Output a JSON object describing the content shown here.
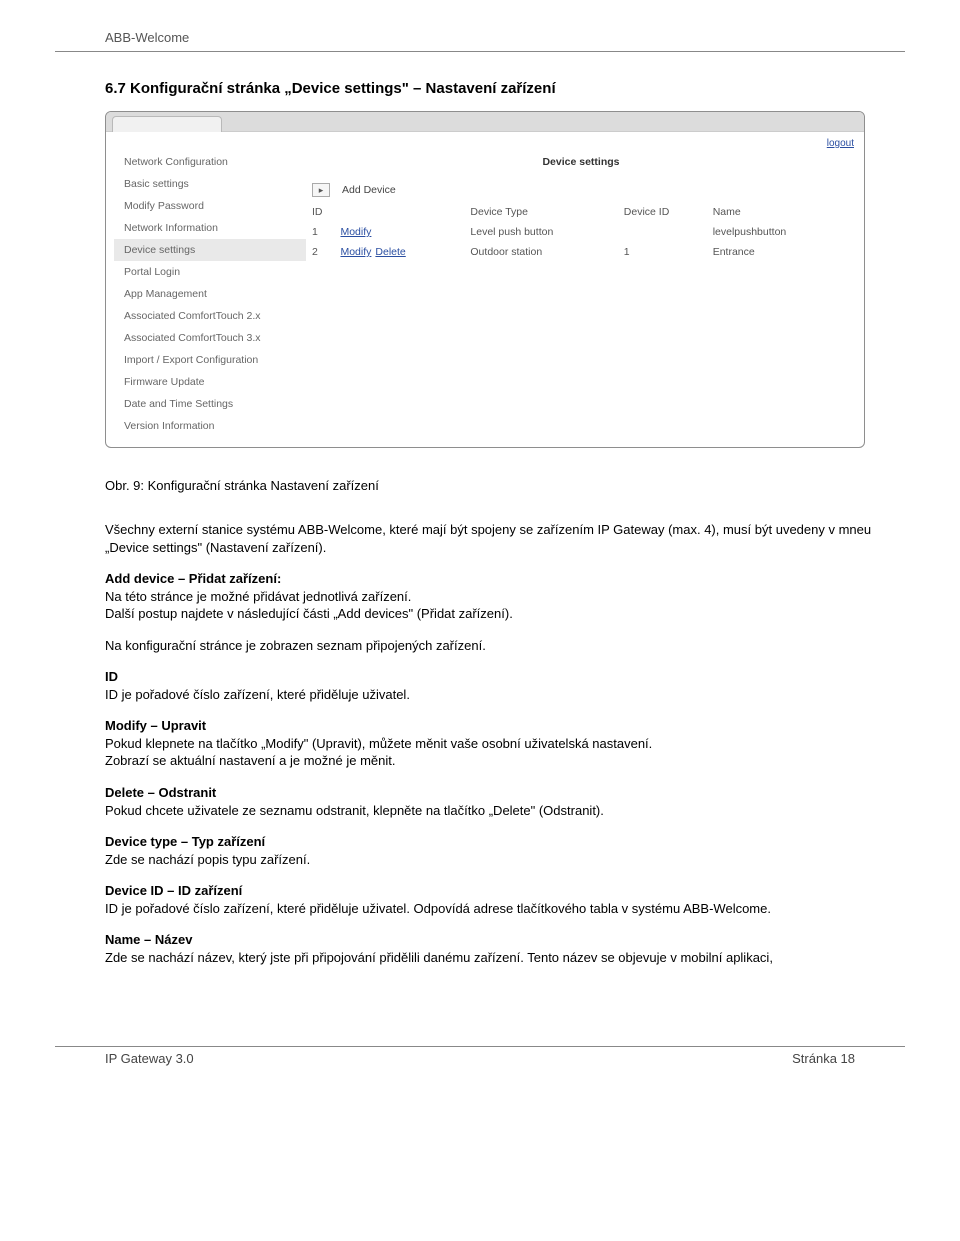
{
  "header": {
    "title": "ABB-Welcome"
  },
  "section": {
    "heading": "6.7 Konfigurační stránka „Device settings\" – Nastavení zařízení"
  },
  "screenshot": {
    "logout_label": "logout",
    "sidebar": [
      "Network Configuration",
      "Basic settings",
      "Modify Password",
      "Network Information",
      "Device settings",
      "Portal Login",
      "App Management",
      "Associated ComfortTouch 2.x",
      "Associated ComfortTouch 3.x",
      "Import / Export Configuration",
      "Firmware Update",
      "Date and Time Settings",
      "Version Information"
    ],
    "active_index": 4,
    "panel_title": "Device settings",
    "add_row": {
      "chevron": "▸",
      "label": "Add Device"
    },
    "table": {
      "headers": [
        "ID",
        "",
        "Device Type",
        "Device ID",
        "Name"
      ],
      "rows": [
        {
          "id": "1",
          "actions": [
            "Modify"
          ],
          "type": "Level push button",
          "device_id": "",
          "name": "levelpushbutton"
        },
        {
          "id": "2",
          "actions": [
            "Modify",
            "Delete"
          ],
          "type": "Outdoor station",
          "device_id": "1",
          "name": "Entrance"
        }
      ]
    }
  },
  "caption": "Obr. 9:   Konfigurační stránka Nastavení zařízení",
  "paragraphs": {
    "intro": "Všechny externí stanice systému ABB-Welcome, které mají být spojeny se zařízením IP Gateway (max. 4), musí být uvedeny v mneu „Device settings\" (Nastavení zařízení).",
    "add_h": "Add device – Přidat zařízení:",
    "add_t1": "Na této stránce je možné přidávat jednotlivá zařízení.",
    "add_t2": "Další postup najdete v následující části „Add devices\" (Přidat zařízení).",
    "list_note": "Na konfigurační stránce je zobrazen seznam připojených zařízení.",
    "id_h": "ID",
    "id_t": "ID je pořadové číslo zařízení, které přiděluje uživatel.",
    "mod_h": "Modify – Upravit",
    "mod_t1": "Pokud klepnete na tlačítko „Modify\" (Upravit), můžete měnit vaše osobní uživatelská nastavení.",
    "mod_t2": "Zobrazí se aktuální nastavení a je možné je měnit.",
    "del_h": "Delete – Odstranit",
    "del_t": "Pokud chcete uživatele ze seznamu odstranit, klepněte na tlačítko „Delete\" (Odstranit).",
    "type_h": "Device type – Typ zařízení",
    "type_t": "Zde se nachází popis typu zařízení.",
    "devid_h": "Device ID – ID zařízení",
    "devid_t": "ID je pořadové číslo zařízení, které přiděluje uživatel. Odpovídá adrese tlačítkového tabla v systému ABB-Welcome.",
    "name_h": "Name – Název",
    "name_t": "Zde se nachází název, který jste při připojování přidělili danému zařízení. Tento název se objevuje v mobilní aplikaci,"
  },
  "footer": {
    "left": "IP Gateway 3.0",
    "right": "Stránka 18"
  }
}
